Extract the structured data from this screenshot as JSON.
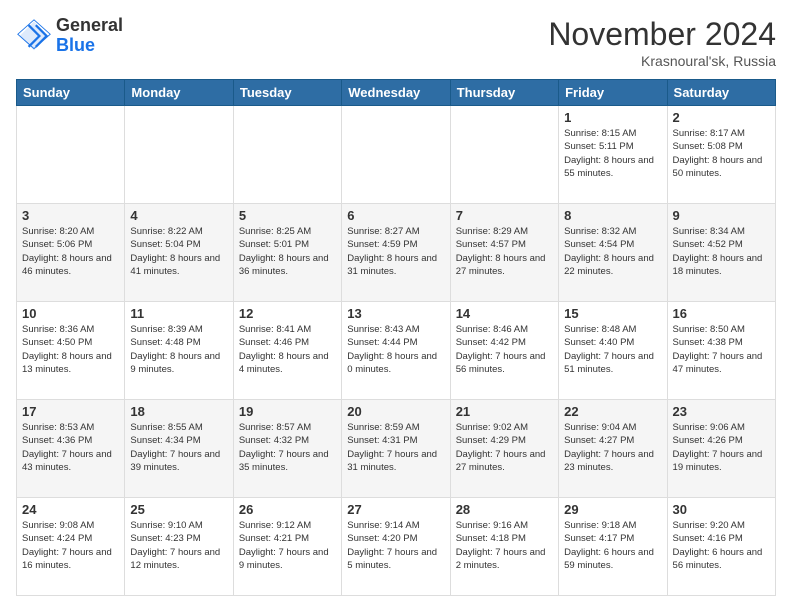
{
  "header": {
    "logo_general": "General",
    "logo_blue": "Blue",
    "month_title": "November 2024",
    "location": "Krasnoural'sk, Russia"
  },
  "weekdays": [
    "Sunday",
    "Monday",
    "Tuesday",
    "Wednesday",
    "Thursday",
    "Friday",
    "Saturday"
  ],
  "weeks": [
    [
      {
        "day": "",
        "info": ""
      },
      {
        "day": "",
        "info": ""
      },
      {
        "day": "",
        "info": ""
      },
      {
        "day": "",
        "info": ""
      },
      {
        "day": "",
        "info": ""
      },
      {
        "day": "1",
        "info": "Sunrise: 8:15 AM\nSunset: 5:11 PM\nDaylight: 8 hours and 55 minutes."
      },
      {
        "day": "2",
        "info": "Sunrise: 8:17 AM\nSunset: 5:08 PM\nDaylight: 8 hours and 50 minutes."
      }
    ],
    [
      {
        "day": "3",
        "info": "Sunrise: 8:20 AM\nSunset: 5:06 PM\nDaylight: 8 hours and 46 minutes."
      },
      {
        "day": "4",
        "info": "Sunrise: 8:22 AM\nSunset: 5:04 PM\nDaylight: 8 hours and 41 minutes."
      },
      {
        "day": "5",
        "info": "Sunrise: 8:25 AM\nSunset: 5:01 PM\nDaylight: 8 hours and 36 minutes."
      },
      {
        "day": "6",
        "info": "Sunrise: 8:27 AM\nSunset: 4:59 PM\nDaylight: 8 hours and 31 minutes."
      },
      {
        "day": "7",
        "info": "Sunrise: 8:29 AM\nSunset: 4:57 PM\nDaylight: 8 hours and 27 minutes."
      },
      {
        "day": "8",
        "info": "Sunrise: 8:32 AM\nSunset: 4:54 PM\nDaylight: 8 hours and 22 minutes."
      },
      {
        "day": "9",
        "info": "Sunrise: 8:34 AM\nSunset: 4:52 PM\nDaylight: 8 hours and 18 minutes."
      }
    ],
    [
      {
        "day": "10",
        "info": "Sunrise: 8:36 AM\nSunset: 4:50 PM\nDaylight: 8 hours and 13 minutes."
      },
      {
        "day": "11",
        "info": "Sunrise: 8:39 AM\nSunset: 4:48 PM\nDaylight: 8 hours and 9 minutes."
      },
      {
        "day": "12",
        "info": "Sunrise: 8:41 AM\nSunset: 4:46 PM\nDaylight: 8 hours and 4 minutes."
      },
      {
        "day": "13",
        "info": "Sunrise: 8:43 AM\nSunset: 4:44 PM\nDaylight: 8 hours and 0 minutes."
      },
      {
        "day": "14",
        "info": "Sunrise: 8:46 AM\nSunset: 4:42 PM\nDaylight: 7 hours and 56 minutes."
      },
      {
        "day": "15",
        "info": "Sunrise: 8:48 AM\nSunset: 4:40 PM\nDaylight: 7 hours and 51 minutes."
      },
      {
        "day": "16",
        "info": "Sunrise: 8:50 AM\nSunset: 4:38 PM\nDaylight: 7 hours and 47 minutes."
      }
    ],
    [
      {
        "day": "17",
        "info": "Sunrise: 8:53 AM\nSunset: 4:36 PM\nDaylight: 7 hours and 43 minutes."
      },
      {
        "day": "18",
        "info": "Sunrise: 8:55 AM\nSunset: 4:34 PM\nDaylight: 7 hours and 39 minutes."
      },
      {
        "day": "19",
        "info": "Sunrise: 8:57 AM\nSunset: 4:32 PM\nDaylight: 7 hours and 35 minutes."
      },
      {
        "day": "20",
        "info": "Sunrise: 8:59 AM\nSunset: 4:31 PM\nDaylight: 7 hours and 31 minutes."
      },
      {
        "day": "21",
        "info": "Sunrise: 9:02 AM\nSunset: 4:29 PM\nDaylight: 7 hours and 27 minutes."
      },
      {
        "day": "22",
        "info": "Sunrise: 9:04 AM\nSunset: 4:27 PM\nDaylight: 7 hours and 23 minutes."
      },
      {
        "day": "23",
        "info": "Sunrise: 9:06 AM\nSunset: 4:26 PM\nDaylight: 7 hours and 19 minutes."
      }
    ],
    [
      {
        "day": "24",
        "info": "Sunrise: 9:08 AM\nSunset: 4:24 PM\nDaylight: 7 hours and 16 minutes."
      },
      {
        "day": "25",
        "info": "Sunrise: 9:10 AM\nSunset: 4:23 PM\nDaylight: 7 hours and 12 minutes."
      },
      {
        "day": "26",
        "info": "Sunrise: 9:12 AM\nSunset: 4:21 PM\nDaylight: 7 hours and 9 minutes."
      },
      {
        "day": "27",
        "info": "Sunrise: 9:14 AM\nSunset: 4:20 PM\nDaylight: 7 hours and 5 minutes."
      },
      {
        "day": "28",
        "info": "Sunrise: 9:16 AM\nSunset: 4:18 PM\nDaylight: 7 hours and 2 minutes."
      },
      {
        "day": "29",
        "info": "Sunrise: 9:18 AM\nSunset: 4:17 PM\nDaylight: 6 hours and 59 minutes."
      },
      {
        "day": "30",
        "info": "Sunrise: 9:20 AM\nSunset: 4:16 PM\nDaylight: 6 hours and 56 minutes."
      }
    ]
  ]
}
